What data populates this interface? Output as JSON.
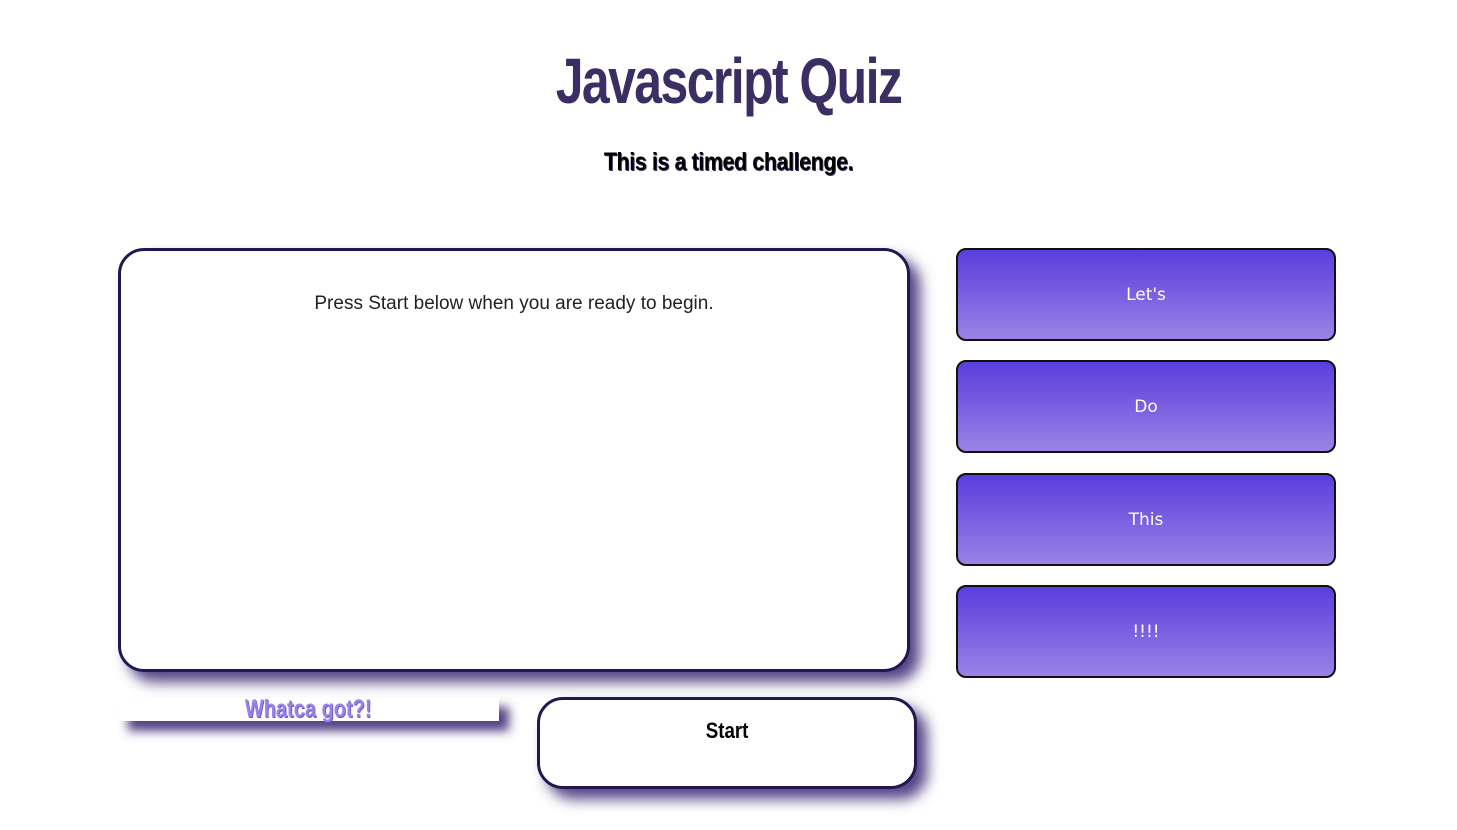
{
  "header": {
    "title": "Javascript Quiz",
    "subtitle": "This is a timed challenge."
  },
  "question_card": {
    "text": "Press Start below when you are ready to begin."
  },
  "answers": [
    {
      "label": "Let's"
    },
    {
      "label": "Do"
    },
    {
      "label": "This"
    },
    {
      "label": "!!!!"
    }
  ],
  "score": {
    "text": "Whatca got?!"
  },
  "controls": {
    "start_label": "Start"
  },
  "colors": {
    "title": "#3b2e63",
    "card_border": "#241650",
    "answer_gradient_top": "#5b3ddd",
    "answer_gradient_bottom": "#9a82e6",
    "score_text": "#9b82e8"
  }
}
